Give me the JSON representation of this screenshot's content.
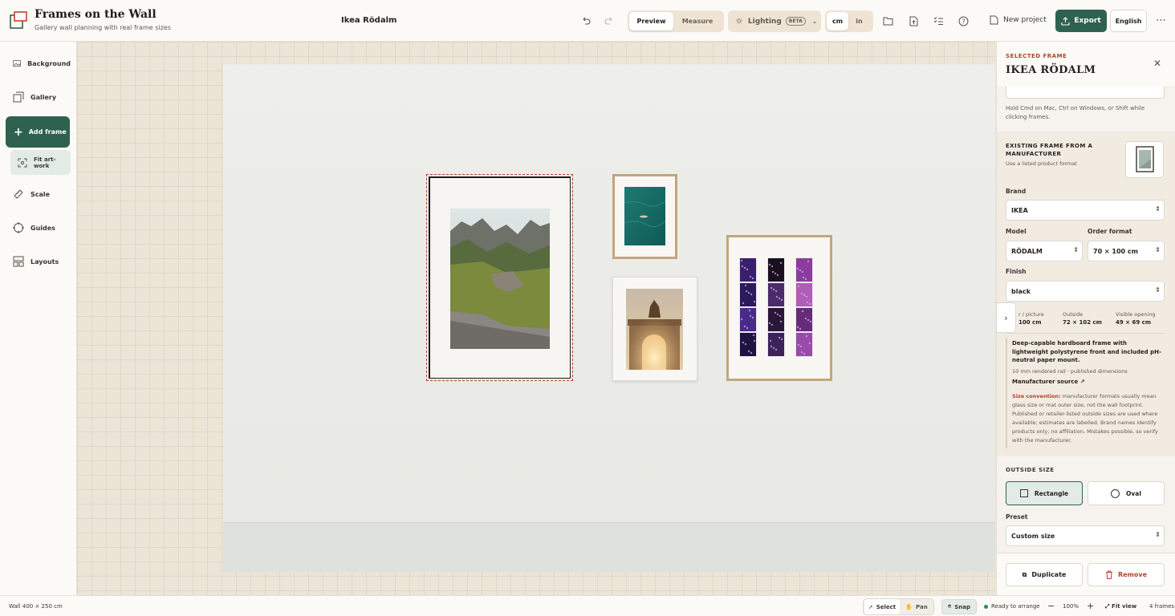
{
  "header": {
    "app_title": "Frames on the Wall",
    "app_subtitle": "Gallery wall planning with real frame sizes",
    "project_name": "Ikea Rödalm",
    "view_modes": [
      "Preview",
      "Measure"
    ],
    "active_view": "Preview",
    "lighting_label": "Lighting",
    "lighting_badge": "BETA",
    "units": [
      "cm",
      "in"
    ],
    "active_unit": "cm",
    "new_project_label": "New project",
    "export_label": "Export",
    "language_label": "English",
    "accent_color": "#2f6150"
  },
  "sidebar": {
    "items": [
      {
        "label": "Background",
        "icon": "image-icon"
      },
      {
        "label": "Gallery",
        "icon": "gallery-icon"
      },
      {
        "label": "Add frame",
        "icon": "plus-icon"
      },
      {
        "label": "Fit art-work",
        "icon": "fit-icon"
      },
      {
        "label": "Scale",
        "icon": "ruler-icon"
      },
      {
        "label": "Guides",
        "icon": "crosshair-icon"
      },
      {
        "label": "Layouts",
        "icon": "layout-icon"
      }
    ]
  },
  "panel": {
    "eyebrow": "SELECTED FRAME",
    "title": "IKEA RÖDALM",
    "hint": "Hold Cmd on Mac, Ctrl on Windows, or Shift while clicking frames.",
    "section_title": "EXISTING FRAME FROM A MANUFACTURER",
    "section_sub": "Use a listed product format",
    "brand_label": "Brand",
    "brand_value": "IKEA",
    "model_label": "Model",
    "model_value": "RÖDALM",
    "order_label": "Order format",
    "order_value": "70 × 100 cm",
    "finish_label": "Finish",
    "finish_value": "black",
    "dims": [
      {
        "label": "r / picture",
        "value": "100 cm"
      },
      {
        "label": "Outside",
        "value": "72 × 102 cm"
      },
      {
        "label": "Visible opening",
        "value": "49 × 69 cm"
      }
    ],
    "description": "Deep-capable hardboard frame with lightweight polystyrene front and included pH-neutral paper mount.",
    "description_note": "10 mm rendered rail · published dimensions",
    "source_label": "Manufacturer source",
    "convention_label": "Size convention:",
    "convention_text": "manufacturer formats usually mean glass size or mat outer size, not the wall footprint. Published or retailer-listed outside sizes are used where available; estimates are labelled. Brand names identify products only; no affiliation. Mistakes possible, so verify with the manufacturer.",
    "outside_size_label": "OUTSIDE SIZE",
    "shape_options": [
      "Rectangle",
      "Oval"
    ],
    "active_shape": "Rectangle",
    "preset_label": "Preset",
    "preset_value": "Custom size",
    "duplicate_label": "Duplicate",
    "remove_label": "Remove",
    "danger_color": "#b0442c"
  },
  "status": {
    "wall": "Wall 400 × 250 cm",
    "select_label": "Select",
    "pan_label": "Pan",
    "snap_label": "Snap",
    "ready": "Ready to arrange",
    "zoom": "100%",
    "fit_view": "Fit view",
    "frame_count": "4 frames"
  }
}
